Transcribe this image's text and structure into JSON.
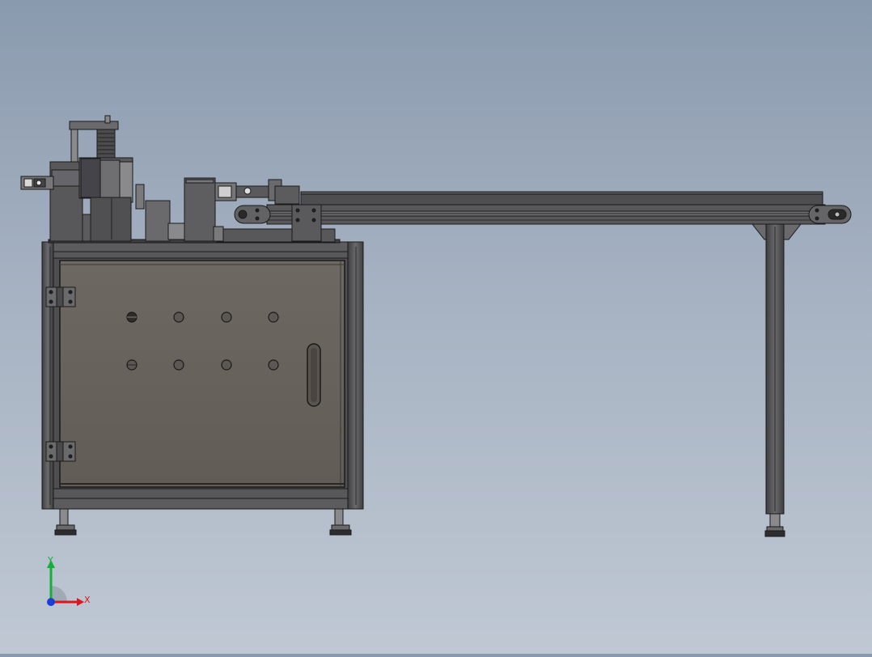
{
  "viewport": {
    "background_top": "#8a9aae",
    "background_bottom": "#bfc8d3",
    "model": {
      "frame_color": "#4e4e50",
      "panel_color": "#6b655f",
      "metal_color": "#5a5a5c",
      "edge_color": "#1a1a1a"
    }
  },
  "triad": {
    "x_label": "X",
    "y_label": "Y",
    "x_color": "#e0141e",
    "y_color": "#13b03a",
    "z_color": "#1a3fd6"
  }
}
